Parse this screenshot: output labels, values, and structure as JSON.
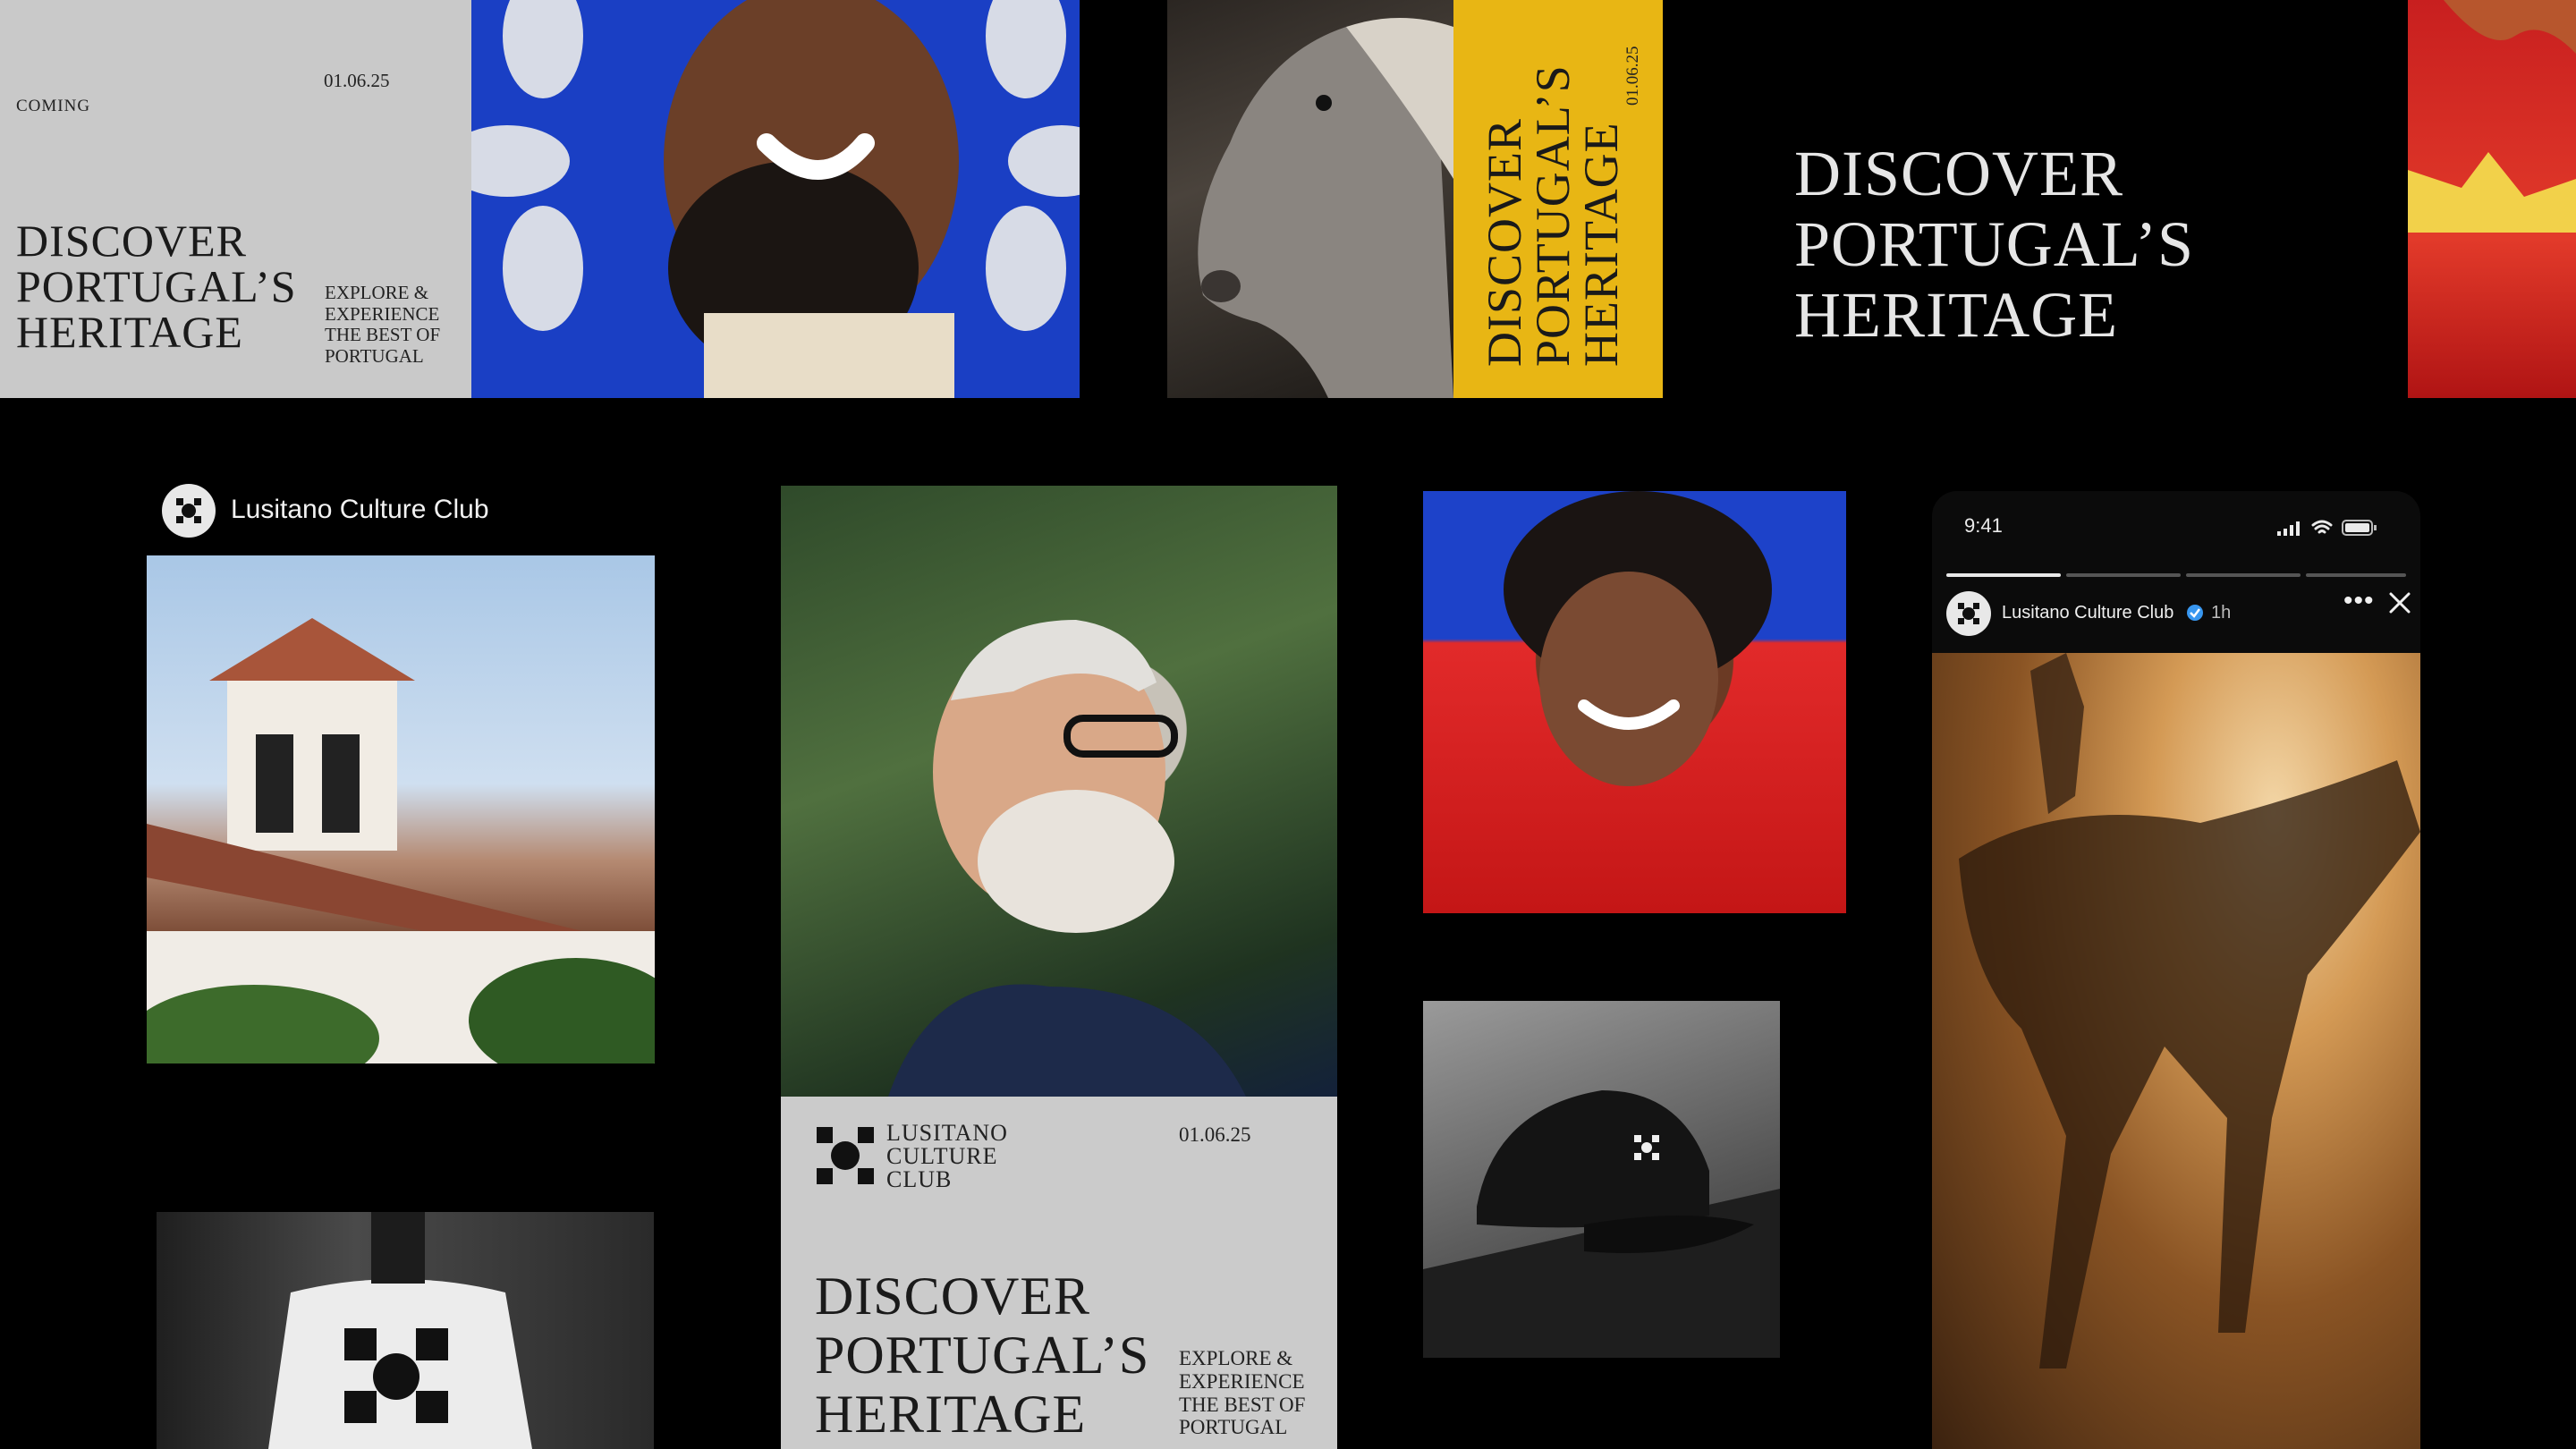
{
  "card1": {
    "coming": "COMING",
    "date": "01.06.25",
    "headline": [
      "DISCOVER",
      "PORTUGAL’S",
      "HERITAGE"
    ],
    "tagline": [
      "EXPLORE &",
      "EXPERIENCE",
      "THE BEST OF",
      "PORTUGAL"
    ]
  },
  "yellow_card": {
    "date": "01.06.25",
    "headline": [
      "DISCOVER",
      "PORTUGAL’S",
      "HERITAGE"
    ]
  },
  "black_card": {
    "headline": [
      "DISCOVER",
      "PORTUGAL’S",
      "HERITAGE"
    ]
  },
  "social_post": {
    "account": "Lusitano Culture Club"
  },
  "poster": {
    "logo_text": [
      "LUSITANO",
      "CULTURE",
      "CLUB"
    ],
    "date": "01.06.25",
    "headline": [
      "DISCOVER",
      "PORTUGAL’S",
      "HERITAGE"
    ],
    "tagline": [
      "EXPLORE &",
      "EXPERIENCE",
      "THE BEST OF",
      "PORTUGAL"
    ]
  },
  "phone": {
    "time": "9:41",
    "account": "Lusitano Culture Club",
    "age": "1h",
    "more_icon": "ellipsis-icon",
    "close_icon": "close-icon"
  },
  "colors": {
    "background": "#000000",
    "royal_blue": "#1a3fc4",
    "mustard": "#e8b614",
    "red": "#d62323",
    "light_gray": "#c9c9c9"
  }
}
